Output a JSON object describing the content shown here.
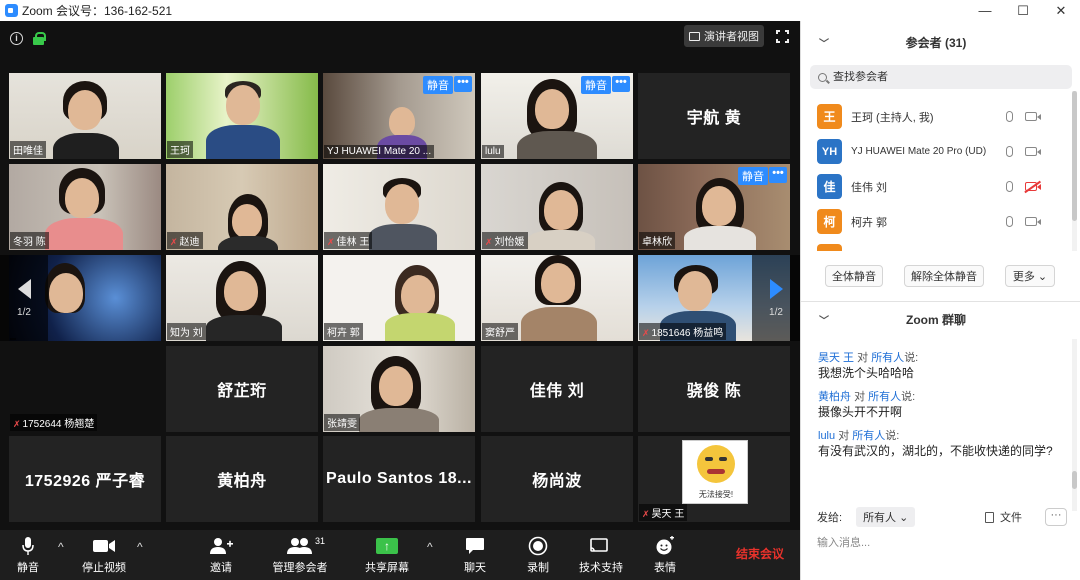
{
  "window": {
    "title": "Zoom 会议号：136-162-521",
    "min": "—",
    "max": "☐",
    "close": "✕"
  },
  "video": {
    "speaker_view_label": "演讲者视图",
    "page_indicator": "1/2",
    "mute_badge": "静音",
    "more_badge": "•••",
    "tiles": [
      {
        "name": "田唯佳",
        "muted": false
      },
      {
        "name": "王珂",
        "muted": false
      },
      {
        "name": "YJ HUAWEI Mate 20 ...",
        "muted": false
      },
      {
        "name": "lulu",
        "muted": false
      },
      {
        "name": "宇航 黄",
        "big": true
      },
      {
        "name": "冬羽 陈",
        "muted": false
      },
      {
        "name": "赵迪",
        "muted": true
      },
      {
        "name": "佳林 王",
        "muted": true
      },
      {
        "name": "刘怡媛",
        "muted": true
      },
      {
        "name": "卓林欣",
        "muted": false
      },
      {
        "name": "",
        "muted": false
      },
      {
        "name": "知为 刘",
        "muted": false
      },
      {
        "name": "柯卉 郭",
        "muted": false
      },
      {
        "name": "窦舒严",
        "muted": false
      },
      {
        "name": "1851646 杨益鸣",
        "muted": true
      },
      {
        "name": "1752644 杨翘楚",
        "muted": true
      },
      {
        "name": "舒芷珩",
        "big": true
      },
      {
        "name": "张靖雯",
        "muted": false
      },
      {
        "name": "佳伟 刘",
        "big": true
      },
      {
        "name": "骁俊 陈",
        "big": true
      },
      {
        "name": "1752926 严子睿",
        "big": true
      },
      {
        "name": "黄柏舟",
        "big": true
      },
      {
        "name": "Paulo Santos 18...",
        "big": true
      },
      {
        "name": "杨尚波",
        "big": true
      },
      {
        "name": "昊天 王",
        "muted": true
      }
    ],
    "sticker_text": "无法接受!"
  },
  "toolbar": {
    "mute": "静音",
    "stop_video": "停止视频",
    "invite": "邀请",
    "manage": "管理参会者",
    "manage_count": "31",
    "share": "共享屏幕",
    "chat": "聊天",
    "record": "录制",
    "support": "技术支持",
    "reactions": "表情",
    "end": "结束会议",
    "caret": "^"
  },
  "panel": {
    "participants_title": "参会者 (31)",
    "search_placeholder": "查找参会者",
    "participants": [
      {
        "avatar": "王",
        "color": "#f08a1c",
        "name": "王珂 (主持人, 我)",
        "cam_off": false
      },
      {
        "avatar": "YH",
        "color": "#2b74c6",
        "name": "YJ HUAWEI Mate 20 Pro (UD)",
        "cam_off": false
      },
      {
        "avatar": "佳",
        "color": "#2b74c6",
        "name": "佳伟 刘",
        "cam_off": true
      },
      {
        "avatar": "柯",
        "color": "#f08a1c",
        "name": "柯卉 郭",
        "cam_off": false
      },
      {
        "avatar": "",
        "color": "#f08a1c",
        "name": "",
        "cam_off": false
      }
    ],
    "mute_all": "全体静音",
    "unmute_all": "解除全体静音",
    "more": "更多 ⌄",
    "chat_title": "Zoom 群聊",
    "messages": [
      {
        "from": "昊天 王",
        "to_word": "对",
        "to": "所有人",
        "said": "说:",
        "text": "我想洗个头哈哈哈"
      },
      {
        "from": "黄柏舟",
        "to_word": "对",
        "to": "所有人",
        "said": "说:",
        "text": "摄像头开不开啊"
      },
      {
        "from": "lulu",
        "to_word": "对",
        "to": "所有人",
        "said": "说:",
        "text": "有没有武汉的，湖北的，不能收快递的同学?"
      }
    ],
    "send_to_label": "发给:",
    "send_to_value": "所有人 ⌄",
    "file_label": "文件",
    "more_chat": "···",
    "input_placeholder": "输入消息..."
  }
}
